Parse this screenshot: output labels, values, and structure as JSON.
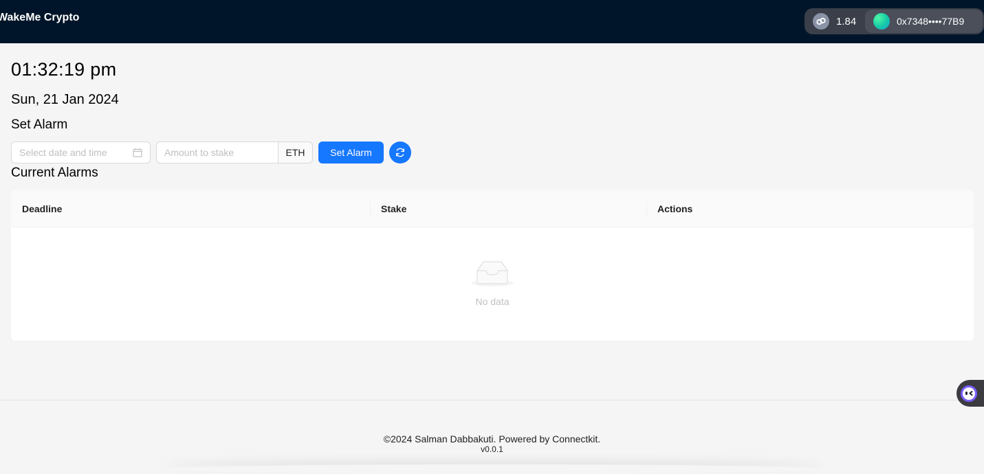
{
  "header": {
    "brand": "WakeMe Crypto",
    "chain_balance": "1.84",
    "chain_icon": "link-icon",
    "account_address": "0x7348••••77B9",
    "account_avatar": "gradient-avatar"
  },
  "clock": {
    "time": "01:32:19 pm",
    "date": "Sun, 21 Jan 2024"
  },
  "alarm_form": {
    "heading": "Set Alarm",
    "date_placeholder": "Select date and time",
    "stake_placeholder": "Amount to stake",
    "stake_unit": "ETH",
    "submit_label": "Set Alarm",
    "refresh_icon": "refresh-icon"
  },
  "alarms": {
    "heading": "Current Alarms",
    "columns": [
      "Deadline",
      "Stake",
      "Actions"
    ],
    "rows": [],
    "empty_text": "No data"
  },
  "footer": {
    "text": "©2024 Salman Dabbakuti. Powered by Connectkit.",
    "version": "v0.0.1"
  },
  "colors": {
    "header_bg": "#001529",
    "primary": "#1677ff",
    "page_bg": "#f5f5f5"
  }
}
